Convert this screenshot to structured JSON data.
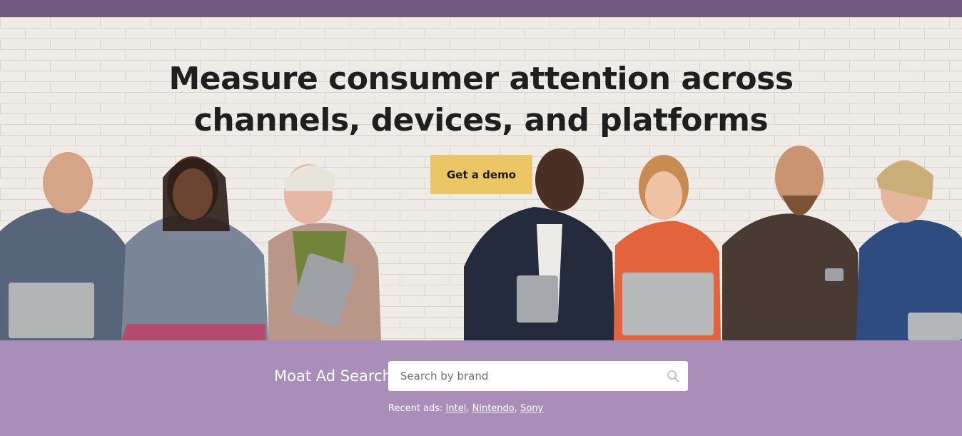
{
  "hero": {
    "headline_line1": "Measure consumer attention across",
    "headline_line2": "channels, devices, and platforms",
    "cta_label": "Get a demo"
  },
  "search": {
    "label": "Moat Ad Search",
    "placeholder": "Search by brand",
    "icon": "search-icon",
    "recent_prefix": "Recent ads:",
    "recent_ads": [
      "Intel",
      "Nintendo",
      "Sony"
    ]
  },
  "colors": {
    "top_bar": "#715a80",
    "search_band": "#a88eb8",
    "cta": "#ecc565"
  }
}
